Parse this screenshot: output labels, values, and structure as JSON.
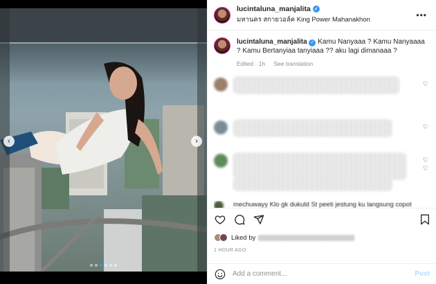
{
  "post": {
    "username": "lucintaluna_manjalita",
    "location": "มหานคร สกายวอล์ค King Power Mahanakhon",
    "more_label": "•••"
  },
  "media": {
    "prev_label": "‹",
    "next_label": "›",
    "slide_count": 6,
    "active_slide": 2
  },
  "caption": {
    "username": "lucintaluna_manjalita",
    "text": "Kamu Nanyaaa ? Kamu Nanyaaaa ? Kamu Bertanyiaa tanyiaaa ?? aku lagi dimanaaa ?",
    "edited": "Edited · 1h",
    "see_translation": "See translation"
  },
  "comments_partial_text": "mechuwayy Klo gk dukuld St peeti jestung ku langsung copot",
  "actions": {
    "liked_by": "Liked by",
    "time_ago": "1 HOUR AGO"
  },
  "add_comment": {
    "placeholder": "Add a comment...",
    "post_label": "Post"
  },
  "colors": {
    "link_blue": "#3897f0",
    "post_disabled": "#b2dffc",
    "muted": "#8e8e8e"
  }
}
